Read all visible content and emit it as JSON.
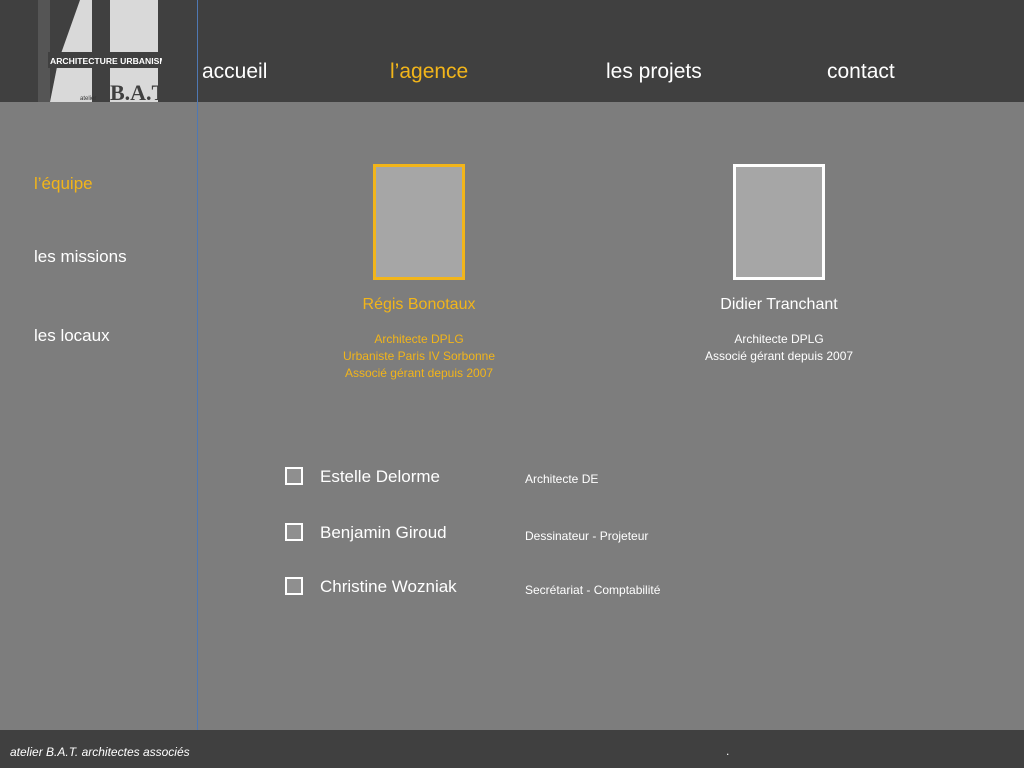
{
  "logo": {
    "line1": "ARCHITECTURE URBANISME",
    "line2_small": "atelier",
    "line2_big": "B.A.T"
  },
  "nav": {
    "items": [
      {
        "label": "accueil"
      },
      {
        "label": "l’agence",
        "active": true
      },
      {
        "label": "les projets"
      },
      {
        "label": "contact"
      }
    ]
  },
  "sidebar": {
    "items": [
      {
        "label": "l’équipe",
        "active": true
      },
      {
        "label": "les missions"
      },
      {
        "label": "les locaux"
      }
    ]
  },
  "partners": [
    {
      "name": "Régis Bonotaux",
      "lines": [
        "Architecte DPLG",
        "Urbaniste Paris IV Sorbonne",
        "Associé gérant depuis 2007"
      ],
      "active": true
    },
    {
      "name": "Didier Tranchant",
      "lines": [
        "Architecte DPLG",
        "Associé gérant depuis 2007"
      ],
      "active": false
    }
  ],
  "staff": [
    {
      "name": "Estelle Delorme",
      "role": "Architecte DE"
    },
    {
      "name": "Benjamin Giroud",
      "role": "Dessinateur - Projeteur"
    },
    {
      "name": "Christine Wozniak",
      "role": "Secrétariat - Comptabilité"
    }
  ],
  "footer": {
    "text": "atelier B.A.T. architectes associés",
    "dot": "."
  },
  "colors": {
    "accent": "#f2b51a",
    "header_bg": "#404040",
    "page_bg": "#7d7d7d",
    "divider": "#4f78b3"
  }
}
